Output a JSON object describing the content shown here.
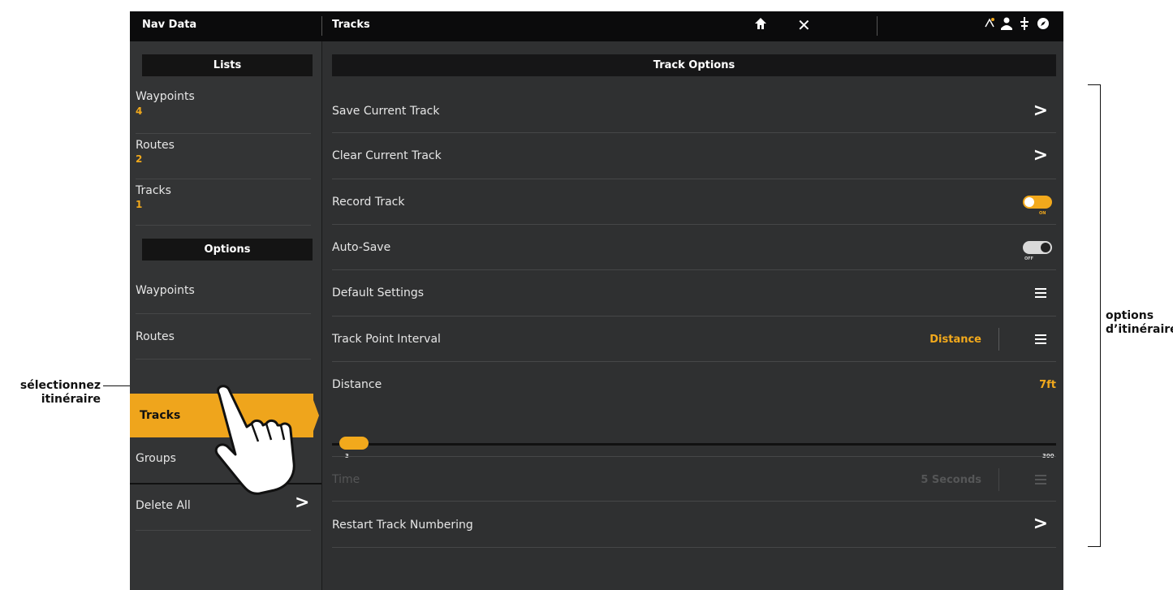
{
  "topbar": {
    "left_title": "Nav Data",
    "right_title": "Tracks",
    "icons": [
      "home-icon",
      "close-icon",
      "gps-icon",
      "person-icon",
      "sonar-icon",
      "compass-icon"
    ]
  },
  "left_panel": {
    "lists_header": "Lists",
    "lists": [
      {
        "label": "Waypoints",
        "count": "4"
      },
      {
        "label": "Routes",
        "count": "2"
      },
      {
        "label": "Tracks",
        "count": "1"
      }
    ],
    "options_header": "Options",
    "options": [
      "Waypoints",
      "Routes",
      "Tracks",
      "Groups"
    ],
    "selected": "Tracks",
    "delete_all": "Delete All"
  },
  "right_panel": {
    "header": "Track Options",
    "rows": {
      "save_current": "Save Current Track",
      "clear_current": "Clear Current Track",
      "record_track": "Record Track",
      "record_track_toggle": "ON",
      "auto_save": "Auto-Save",
      "auto_save_toggle": "OFF",
      "default_settings": "Default Settings",
      "track_point_interval": "Track Point Interval",
      "track_point_interval_value": "Distance",
      "distance": "Distance",
      "distance_value": "7ft",
      "time": "Time",
      "time_value": "5 Seconds",
      "restart_numbering": "Restart Track Numbering"
    },
    "slider": {
      "min": "3",
      "max": "300",
      "value": 7
    }
  },
  "annotations": {
    "select_line1": "sélectionnez",
    "select_line2": "itinéraire",
    "options_line1": "options",
    "options_line2": "d’itinéraire"
  },
  "colors": {
    "accent": "#f2a91c",
    "screen_bg": "#2f3031",
    "topbar_bg": "#0b0b0c"
  }
}
